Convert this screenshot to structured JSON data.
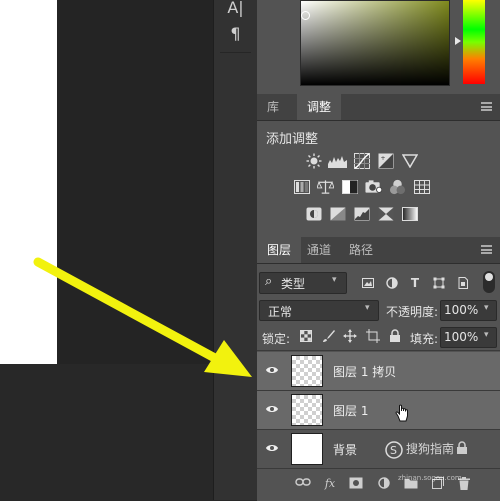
{
  "toolbar": {
    "text_tool_glyph": "A|",
    "paragraph_glyph": "¶"
  },
  "adjust_panel": {
    "tabs": [
      "库",
      "调整"
    ],
    "active_tab": "调整",
    "title": "添加调整",
    "icons": [
      [
        "brightness-icon",
        "levels-icon",
        "curves-icon",
        "exposure-icon",
        "vibrance-icon"
      ],
      [
        "hue-saturation-icon",
        "color-balance-icon",
        "black-white-icon",
        "photo-filter-icon",
        "channel-mixer-icon",
        "color-lookup-icon"
      ],
      [
        "invert-icon",
        "posterize-icon",
        "threshold-icon",
        "selective-color-icon",
        "gradient-map-icon"
      ]
    ]
  },
  "layers_panel": {
    "tabs": [
      "图层",
      "通道",
      "路径"
    ],
    "active_tab": "图层",
    "filter_label": "类型",
    "blend_mode": "正常",
    "opacity_label": "不透明度:",
    "opacity_value": "100%",
    "lock_label": "锁定:",
    "fill_label": "填充:",
    "fill_value": "100%",
    "layers": [
      {
        "name": "图层 1 拷贝",
        "thumb": "transparent",
        "selected": true
      },
      {
        "name": "图层 1",
        "thumb": "transparent",
        "selected": true
      },
      {
        "name": "背景",
        "thumb": "white",
        "selected": false
      }
    ],
    "bottom_icons": [
      "link-icon",
      "fx-icon",
      "mask-icon",
      "adjustment-icon",
      "group-icon",
      "new-layer-icon",
      "trash-icon"
    ],
    "fx_label": "fx"
  },
  "watermark": {
    "text": "搜狗指南",
    "sub": "zhinan.sogou.com"
  },
  "colors": {
    "arrow": "#f2f20e",
    "panel_bg": "#535353",
    "selected_row": "#6a6a6a"
  }
}
